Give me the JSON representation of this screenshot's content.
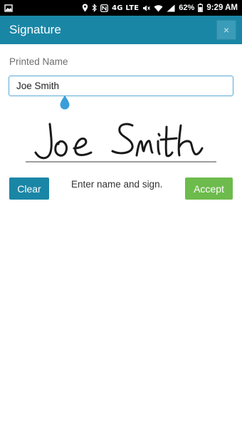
{
  "status_bar": {
    "network_text": "4G LTE",
    "battery": "62%",
    "time": "9:29 AM",
    "icons": [
      "image-icon",
      "location-icon",
      "bluetooth-icon",
      "nfc-icon",
      "mute-icon",
      "wifi-icon",
      "signal-icon",
      "battery-icon"
    ]
  },
  "app_bar": {
    "title": "Signature",
    "close_label": "×"
  },
  "form": {
    "label": "Printed Name",
    "name_value": "Joe Smith"
  },
  "actions": {
    "clear_label": "Clear",
    "hint": "Enter name and sign.",
    "accept_label": "Accept"
  },
  "colors": {
    "primary": "#1a86a6",
    "accept": "#6dbb4c",
    "input_border": "#5aa9d6"
  }
}
